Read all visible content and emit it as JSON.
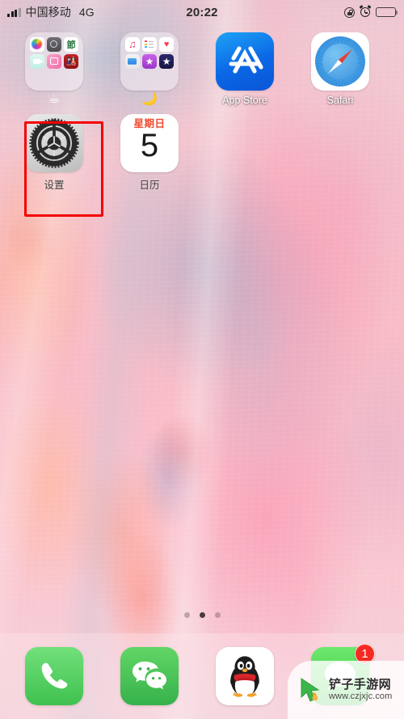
{
  "status_bar": {
    "signal_icon": "signal-bars-icon",
    "carrier": "中国移动",
    "network": "4G",
    "time": "20:22",
    "rotation_lock_icon": "rotation-lock-icon",
    "alarm_icon": "alarm-clock-icon",
    "battery_icon": "battery-icon"
  },
  "home_screen": {
    "rows": [
      {
        "items": [
          {
            "type": "folder",
            "name": "folder-1",
            "label": "☕",
            "apps": [
              {
                "name": "photos",
                "glyph": ""
              },
              {
                "name": "camera",
                "glyph": ""
              },
              {
                "name": "chinese-app",
                "glyph": "節"
              },
              {
                "name": "facetime",
                "glyph": ""
              },
              {
                "name": "instagram",
                "glyph": ""
              },
              {
                "name": "red-app",
                "glyph": ""
              }
            ]
          },
          {
            "type": "folder",
            "name": "folder-2",
            "label": "🌙",
            "apps": [
              {
                "name": "music",
                "glyph": "♫"
              },
              {
                "name": "reminders",
                "glyph": ""
              },
              {
                "name": "health",
                "glyph": "♥"
              },
              {
                "name": "files",
                "glyph": ""
              },
              {
                "name": "podcasts",
                "glyph": "★"
              },
              {
                "name": "imovie",
                "glyph": "★"
              }
            ]
          },
          {
            "type": "app",
            "name": "app-store",
            "label": "App Store"
          },
          {
            "type": "app",
            "name": "safari",
            "label": "Safari"
          }
        ]
      },
      {
        "items": [
          {
            "type": "app",
            "name": "settings",
            "label": "设置",
            "highlighted": true
          },
          {
            "type": "app",
            "name": "calendar",
            "label": "日历",
            "day_of_week": "星期日",
            "day_number": "5"
          }
        ]
      }
    ],
    "page_dots": {
      "count": 3,
      "active_index": 1
    }
  },
  "dock": {
    "items": [
      {
        "name": "phone",
        "badge": null
      },
      {
        "name": "wechat",
        "badge": null
      },
      {
        "name": "qq",
        "badge": null
      },
      {
        "name": "messages",
        "badge": "1"
      }
    ]
  },
  "watermark": {
    "logo_icon": "cursor-logo-icon",
    "title": "铲子手游网",
    "url": "www.czjxjc.com"
  },
  "colors": {
    "highlight": "#f40000",
    "badge": "#f62a22",
    "calendar_red": "#f1482f",
    "app_store_blue": "#0b67e6"
  }
}
